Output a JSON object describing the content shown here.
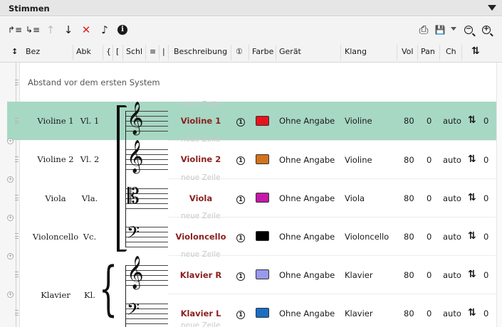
{
  "panel": {
    "title": "Stimmen"
  },
  "toolbar": {
    "buttons": [
      {
        "name": "add-staff-icon",
        "glyph": "↱≡"
      },
      {
        "name": "add-multi-staff-icon",
        "glyph": "↳≡"
      },
      {
        "name": "move-up-icon",
        "glyph": "↑"
      },
      {
        "name": "move-down-icon",
        "glyph": "↓"
      },
      {
        "name": "delete-icon",
        "glyph": "✕"
      },
      {
        "name": "instrument-icon",
        "glyph": "♪"
      },
      {
        "name": "info-icon",
        "glyph": "i"
      }
    ],
    "right": [
      {
        "name": "print-icon",
        "glyph": "⎙"
      },
      {
        "name": "save-icon",
        "glyph": "💾"
      },
      {
        "name": "zoom-out-icon",
        "glyph": "−"
      },
      {
        "name": "zoom-in-icon",
        "glyph": "+"
      }
    ]
  },
  "columns": {
    "drag": "↕",
    "bez": "Bez",
    "abk": "Abk",
    "brace": "{",
    "bracket": "[",
    "schl": "Schl",
    "lines": "≡",
    "bar": "|",
    "beschreibung": "Beschreibung",
    "one": "①",
    "farbe": "Farbe",
    "geraet": "Gerät",
    "klang": "Klang",
    "vol": "Vol",
    "pan": "Pan",
    "ch": "Ch",
    "sort": "⇅"
  },
  "spacing_row": "Abstand vor dem ersten System",
  "neue_zeile": "neue Zeile",
  "rows": [
    {
      "bez": "Violine 1",
      "abk": "Vl. 1",
      "beschreibung": "Violine 1",
      "one": "1",
      "color": "#e8141c",
      "geraet": "Ohne Angabe",
      "klang": "Violine",
      "vol": "80",
      "pan": "0",
      "ch": "auto",
      "swap": "⇅",
      "transp": "0"
    },
    {
      "bez": "Violine 2",
      "abk": "Vl. 2",
      "beschreibung": "Violine 2",
      "one": "1",
      "color": "#d4711c",
      "geraet": "Ohne Angabe",
      "klang": "Violine",
      "vol": "80",
      "pan": "0",
      "ch": "auto",
      "swap": "⇅",
      "transp": "0"
    },
    {
      "bez": "Viola",
      "abk": "Vla.",
      "beschreibung": "Viola",
      "one": "1",
      "color": "#c418a8",
      "geraet": "Ohne Angabe",
      "klang": "Viola",
      "vol": "80",
      "pan": "0",
      "ch": "auto",
      "swap": "⇅",
      "transp": "0"
    },
    {
      "bez": "Violoncello",
      "abk": "Vc.",
      "beschreibung": "Violoncello",
      "one": "1",
      "color": "#000000",
      "geraet": "Ohne Angabe",
      "klang": "Violoncello",
      "vol": "80",
      "pan": "0",
      "ch": "auto",
      "swap": "⇅",
      "transp": "0"
    },
    {
      "bez": "Klavier",
      "abk": "Kl.",
      "beschreibung": "Klavier R",
      "one": "1",
      "color": "#9999ee",
      "geraet": "Ohne Angabe",
      "klang": "Klavier",
      "vol": "80",
      "pan": "0",
      "ch": "auto",
      "swap": "⇅",
      "transp": "0"
    },
    {
      "bez": "",
      "abk": "",
      "beschreibung": "Klavier L",
      "one": "1",
      "color": "#1a6fc4",
      "geraet": "Ohne Angabe",
      "klang": "Klavier",
      "vol": "80",
      "pan": "0",
      "ch": "auto",
      "swap": "⇅",
      "transp": "0"
    }
  ],
  "clefs": {
    "treble": "𝄞",
    "alto": "𝄡",
    "bass": "𝄢",
    "brace": "{"
  }
}
